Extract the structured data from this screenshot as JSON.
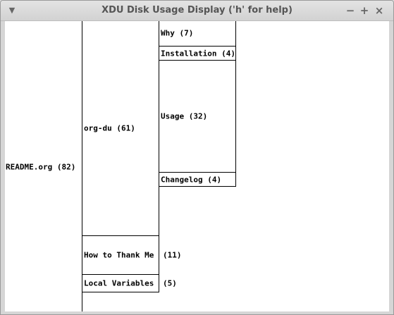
{
  "window": {
    "title": "XDU Disk Usage Display ('h' for help)",
    "menu_icon": "chevron-down-icon",
    "minimize_icon": "minimize-icon",
    "maximize_icon": "maximize-icon",
    "close_icon": "close-icon"
  },
  "tree": {
    "root": {
      "label": "README.org (82)"
    },
    "org_du": {
      "label": "org-du (61)"
    },
    "why": {
      "label": "Why (7)"
    },
    "installation": {
      "label": "Installation (4)"
    },
    "usage": {
      "label": "Usage (32)"
    },
    "changelog": {
      "label": "Changelog (4)"
    },
    "thank_me": {
      "label": "How to Thank Me",
      "size_suffix": "(11)"
    },
    "local_vars": {
      "label": "Local Variables",
      "size_suffix": "(5)"
    }
  }
}
